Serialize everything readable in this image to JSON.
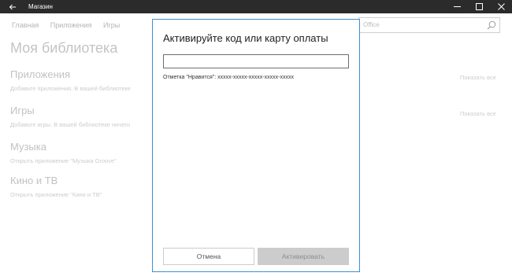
{
  "window": {
    "title": "Магазин"
  },
  "background": {
    "nav_tabs": [
      "Главная",
      "Приложения",
      "Игры"
    ],
    "search_value": "Office",
    "page_title": "Моя библиотека",
    "sections": [
      {
        "title": "Приложения",
        "description": "Добавьте приложения. В вашей библиотеке",
        "show_all": "Показать все"
      },
      {
        "title": "Игры",
        "description": "Добавьте игры. В вашей библиотеке ничего",
        "show_all": "Показать все"
      },
      {
        "title": "Музыка",
        "description": "Открыть приложение \"Музыка Groove\""
      },
      {
        "title": "Кино и ТВ",
        "description": "Открыть приложение \"Кино и ТВ\""
      }
    ]
  },
  "dialog": {
    "title": "Активируйте код или карту оплаты",
    "input_value": "",
    "hint": "Отметка \"Нравится\": xxxxx-xxxxx-xxxxx-xxxxx-xxxxx",
    "cancel_label": "Отмена",
    "activate_label": "Активировать"
  },
  "colors": {
    "titlebar": "#2b2b2b",
    "dialog_border": "#3f8fd4",
    "disabled_button": "#cccccc"
  }
}
